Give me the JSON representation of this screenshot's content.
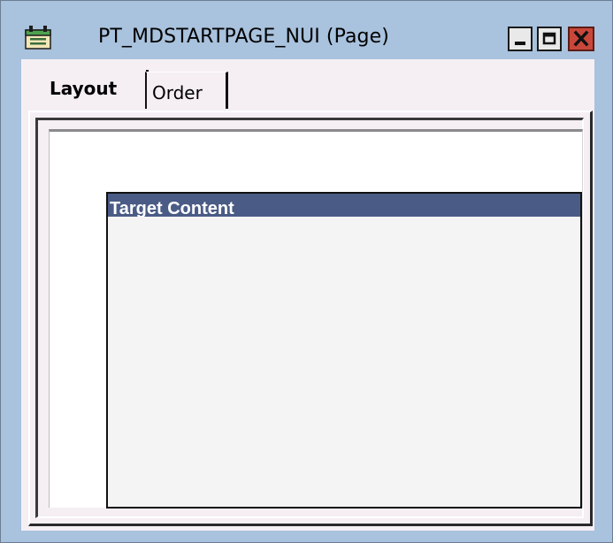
{
  "window": {
    "title": "PT_MDSTARTPAGE_NUI (Page)",
    "icon": "page-definition-icon",
    "controls": {
      "minimize_icon": "minimize-icon",
      "maximize_icon": "maximize-icon",
      "close_icon": "close-icon",
      "close_color": "#c9473a"
    }
  },
  "tabs": [
    {
      "label": "Layout",
      "selected": true
    },
    {
      "label": "Order",
      "selected": false
    }
  ],
  "page": {
    "groupbox": {
      "label": "Target Content",
      "header_color": "#4a5b86"
    }
  },
  "colors": {
    "frame_background": "#a9c2dd",
    "client_background": "#f5eff4"
  }
}
